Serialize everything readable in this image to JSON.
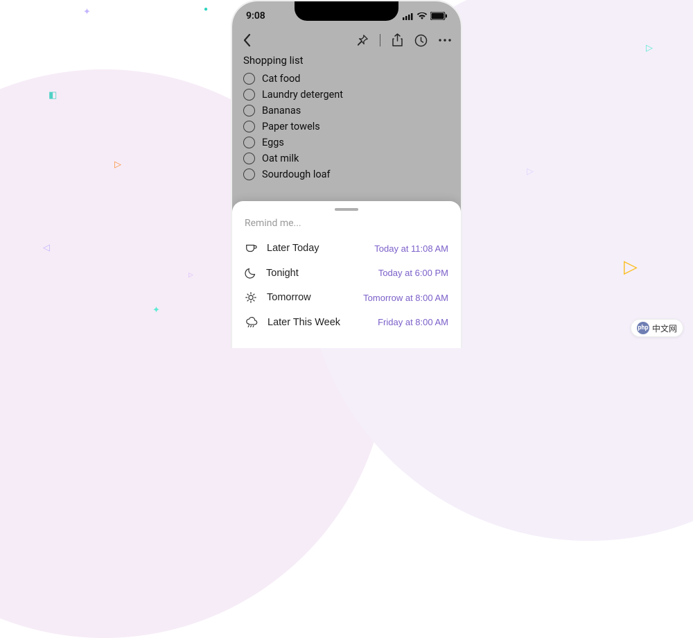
{
  "status": {
    "time": "9:08"
  },
  "note": {
    "title": "Shopping list",
    "items": [
      "Cat food",
      "Laundry detergent",
      "Bananas",
      "Paper towels",
      "Eggs",
      "Oat milk",
      "Sourdough loaf"
    ]
  },
  "sheet": {
    "title": "Remind me...",
    "options": [
      {
        "icon": "cup",
        "label": "Later Today",
        "time": "Today at 11:08 AM"
      },
      {
        "icon": "moon",
        "label": "Tonight",
        "time": "Today at 6:00 PM"
      },
      {
        "icon": "sun",
        "label": "Tomorrow",
        "time": "Tomorrow at 8:00 AM"
      },
      {
        "icon": "cloud",
        "label": "Later This Week",
        "time": "Friday at 8:00 AM"
      }
    ]
  },
  "badge": {
    "logo": "php",
    "text": "中文网"
  },
  "colors": {
    "accent": "#7b5fc9"
  }
}
